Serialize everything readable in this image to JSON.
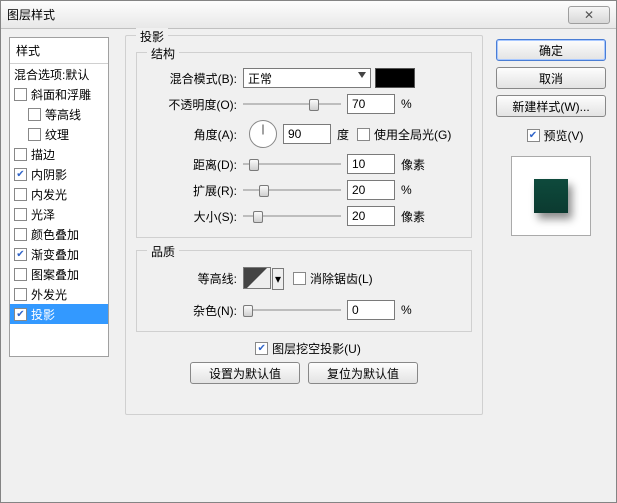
{
  "window": {
    "title": "图层样式"
  },
  "sidebar": {
    "header": "样式",
    "blend_defaults": "混合选项:默认",
    "items": [
      {
        "label": "斜面和浮雕",
        "checked": false,
        "selected": false
      },
      {
        "label": "等高线",
        "checked": false,
        "selected": false,
        "indent": true
      },
      {
        "label": "纹理",
        "checked": false,
        "selected": false,
        "indent": true
      },
      {
        "label": "描边",
        "checked": false,
        "selected": false
      },
      {
        "label": "内阴影",
        "checked": true,
        "selected": false
      },
      {
        "label": "内发光",
        "checked": false,
        "selected": false
      },
      {
        "label": "光泽",
        "checked": false,
        "selected": false
      },
      {
        "label": "颜色叠加",
        "checked": false,
        "selected": false
      },
      {
        "label": "渐变叠加",
        "checked": true,
        "selected": false
      },
      {
        "label": "图案叠加",
        "checked": false,
        "selected": false
      },
      {
        "label": "外发光",
        "checked": false,
        "selected": false
      },
      {
        "label": "投影",
        "checked": true,
        "selected": true
      }
    ]
  },
  "panel": {
    "title": "投影",
    "structure": {
      "title": "结构",
      "blend_mode_label": "混合模式(B):",
      "blend_mode_value": "正常",
      "color": "#000000",
      "opacity_label": "不透明度(O):",
      "opacity_value": "70",
      "opacity_unit": "%",
      "angle_label": "角度(A):",
      "angle_value": "90",
      "angle_unit": "度",
      "global_light_label": "使用全局光(G)",
      "global_light_checked": false,
      "distance_label": "距离(D):",
      "distance_value": "10",
      "distance_unit": "像素",
      "spread_label": "扩展(R):",
      "spread_value": "20",
      "spread_unit": "%",
      "size_label": "大小(S):",
      "size_value": "20",
      "size_unit": "像素"
    },
    "quality": {
      "title": "品质",
      "contour_label": "等高线:",
      "antialias_label": "消除锯齿(L)",
      "antialias_checked": false,
      "noise_label": "杂色(N):",
      "noise_value": "0",
      "noise_unit": "%"
    },
    "knockout_label": "图层挖空投影(U)",
    "knockout_checked": true,
    "reset_default": "设置为默认值",
    "restore_default": "复位为默认值"
  },
  "right": {
    "ok": "确定",
    "cancel": "取消",
    "new_style": "新建样式(W)...",
    "preview_label": "预览(V)",
    "preview_checked": true
  }
}
